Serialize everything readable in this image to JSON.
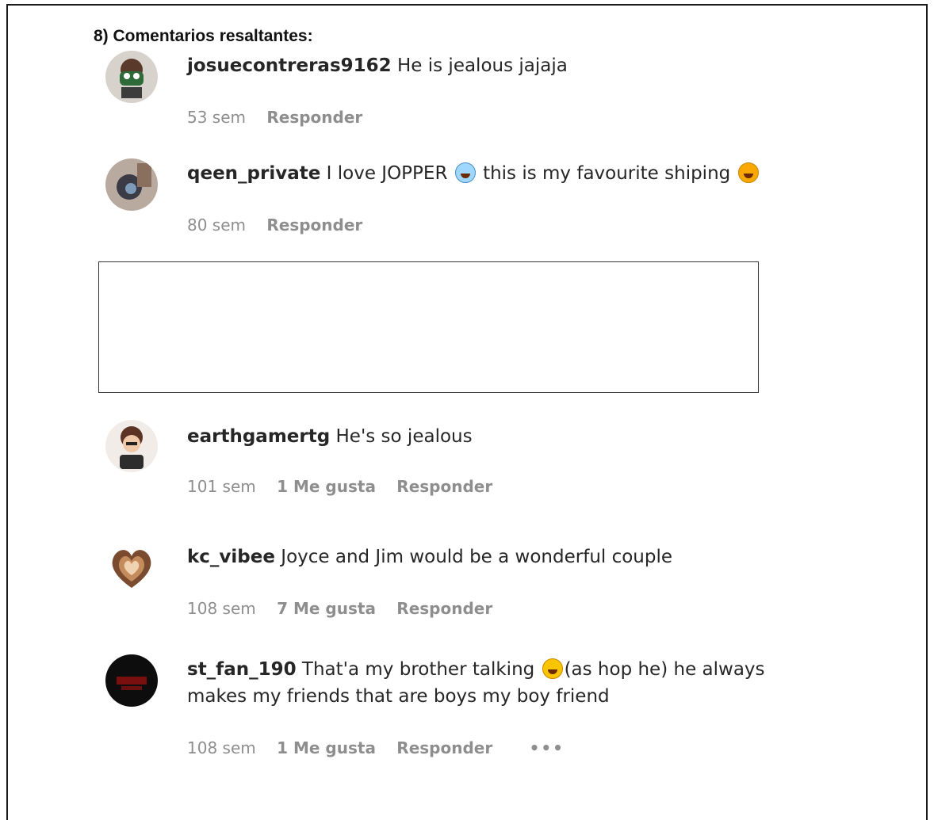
{
  "heading": "8) Comentarios resaltantes:",
  "comments": [
    {
      "username": "josuecontreras9162",
      "text": "He is jealous jajaja",
      "time": "53 sem",
      "likes": "",
      "reply": "Responder"
    },
    {
      "username": "qeen_private",
      "text_before": "I love JOPPER",
      "emoji1": "crying-emoji",
      "text_middle": "this is my favourite shiping",
      "emoji2": "heart-eyes-emoji",
      "time": "80 sem",
      "reply": "Responder"
    },
    {
      "username": "earthgamertg",
      "text": "He's so jealous",
      "time": "101 sem",
      "likes": "1 Me gusta",
      "reply": "Responder"
    },
    {
      "username": "kc_vibee",
      "text": "Joyce and Jim would be a wonderful couple",
      "time": "108 sem",
      "likes": "7 Me gusta",
      "reply": "Responder"
    },
    {
      "username": "st_fan_190",
      "text_before": "That'a my brother talking",
      "emoji1": "laughing-emoji",
      "text_after": "(as hop he) he always makes my friends that are boys my boy friend",
      "time": "108 sem",
      "likes": "1 Me gusta",
      "reply": "Responder",
      "more": "•••"
    }
  ]
}
